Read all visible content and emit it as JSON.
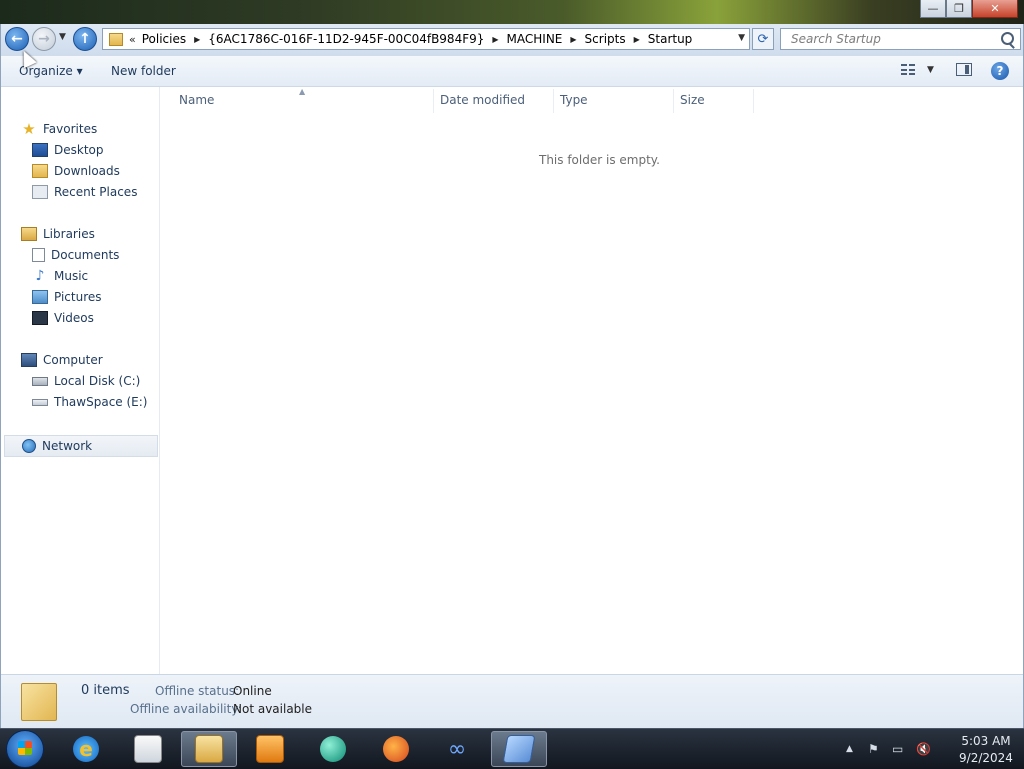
{
  "window": {
    "buttons": {
      "minimize": "—",
      "restore": "❐",
      "close": "✕"
    }
  },
  "navbar": {
    "back_glyph": "←",
    "forward_glyph": "→",
    "up_glyph": "↑",
    "chevron": "«",
    "breadcrumb": [
      "Policies",
      "{6AC1786C-016F-11D2-945F-00C04fB984F9}",
      "MACHINE",
      "Scripts",
      "Startup"
    ],
    "search_placeholder": "Search Startup"
  },
  "toolbar": {
    "organize_label": "Organize ▾",
    "new_folder_label": "New folder"
  },
  "sidebar": {
    "favorites": {
      "label": "Favorites",
      "items": [
        "Desktop",
        "Downloads",
        "Recent Places"
      ]
    },
    "libraries": {
      "label": "Libraries",
      "items": [
        "Documents",
        "Music",
        "Pictures",
        "Videos"
      ]
    },
    "computer": {
      "label": "Computer",
      "items": [
        "Local Disk (C:)",
        "ThawSpace (E:)"
      ]
    },
    "network": {
      "label": "Network"
    }
  },
  "content": {
    "columns": [
      "Name",
      "Date modified",
      "Type",
      "Size"
    ],
    "empty_message": "This folder is empty."
  },
  "details": {
    "count": "0 items",
    "offline_status_label": "Offline status:",
    "offline_status_value": "Online",
    "offline_availability_label": "Offline availability:",
    "offline_availability_value": "Not available"
  },
  "taskbar": {
    "apps": [
      "internet-explorer",
      "notepad",
      "windows-explorer",
      "media-player",
      "swirl-app",
      "firefox",
      "infinity-app",
      "paper-app"
    ],
    "time": "5:03 AM",
    "date": "9/2/2024"
  }
}
